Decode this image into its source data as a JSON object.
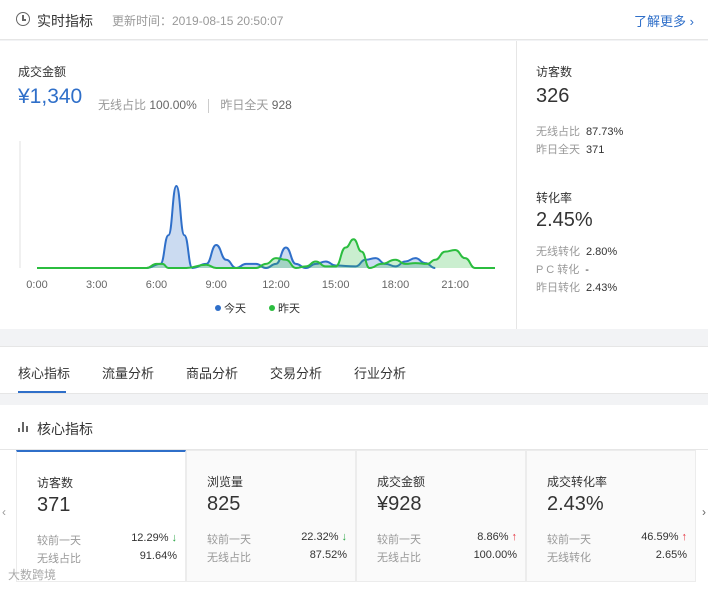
{
  "header": {
    "title": "实时指标",
    "update_time": "更新时间：2019-08-15 20:50:07",
    "more_link": "了解更多 ›"
  },
  "sales": {
    "label": "成交金额",
    "value": "¥1,340",
    "wireless_label": "无线占比",
    "wireless_value": "100.00%",
    "yesterday_label": "昨日全天",
    "yesterday_value": "928"
  },
  "visitors": {
    "label": "访客数",
    "value": "326",
    "rows": [
      {
        "label": "无线占比",
        "value": "87.73%"
      },
      {
        "label": "昨日全天",
        "value": "371"
      }
    ]
  },
  "conversion": {
    "label": "转化率",
    "value": "2.45%",
    "rows": [
      {
        "label": "无线转化",
        "value": "2.80%"
      },
      {
        "label": "P C 转化",
        "value": "-"
      },
      {
        "label": "昨日转化",
        "value": "2.43%"
      }
    ]
  },
  "chart_data": {
    "type": "area",
    "x": [
      "0:00",
      "3:00",
      "6:00",
      "9:00",
      "12:00",
      "15:00",
      "18:00",
      "21:00"
    ],
    "x_range": [
      0,
      23
    ],
    "series": [
      {
        "name": "今天",
        "color": "#2f6fc9",
        "points": [
          [
            0,
            0
          ],
          [
            5.5,
            0
          ],
          [
            6.2,
            0.05
          ],
          [
            6.6,
            0.4
          ],
          [
            7,
            1.0
          ],
          [
            7.4,
            0.4
          ],
          [
            7.8,
            0
          ],
          [
            8.5,
            0.05
          ],
          [
            9,
            0.28
          ],
          [
            9.5,
            0.1
          ],
          [
            10,
            0
          ],
          [
            10.5,
            0.05
          ],
          [
            11,
            0.05
          ],
          [
            11.5,
            0
          ],
          [
            12,
            0.05
          ],
          [
            12.5,
            0.25
          ],
          [
            13,
            0.05
          ],
          [
            13.5,
            0
          ],
          [
            14,
            0.05
          ],
          [
            14.5,
            0.08
          ],
          [
            15,
            0.03
          ],
          [
            16,
            0.02
          ],
          [
            16.5,
            0.1
          ],
          [
            17,
            0.12
          ],
          [
            17.5,
            0.05
          ],
          [
            18,
            0.02
          ],
          [
            18.5,
            0.08
          ],
          [
            19,
            0.12
          ],
          [
            19.5,
            0.06
          ],
          [
            20,
            0
          ]
        ]
      },
      {
        "name": "昨天",
        "color": "#2bbd3f",
        "points": [
          [
            0,
            0
          ],
          [
            5.5,
            0
          ],
          [
            6,
            0.05
          ],
          [
            6.3,
            0.05
          ],
          [
            6.6,
            0
          ],
          [
            7.5,
            0
          ],
          [
            8.5,
            0.04
          ],
          [
            9,
            0
          ],
          [
            11,
            0
          ],
          [
            11.5,
            0.05
          ],
          [
            12,
            0.12
          ],
          [
            12.5,
            0.1
          ],
          [
            13,
            0
          ],
          [
            13.5,
            0.02
          ],
          [
            14,
            0.08
          ],
          [
            14.5,
            0.02
          ],
          [
            15,
            0.02
          ],
          [
            15.5,
            0.25
          ],
          [
            15.9,
            0.35
          ],
          [
            16.3,
            0.2
          ],
          [
            16.7,
            0
          ],
          [
            17.3,
            0.05
          ],
          [
            18,
            0.1
          ],
          [
            18.5,
            0.05
          ],
          [
            19,
            0.06
          ],
          [
            19.6,
            0.05
          ],
          [
            20,
            0.1
          ],
          [
            20.5,
            0.2
          ],
          [
            21,
            0.22
          ],
          [
            21.5,
            0.12
          ],
          [
            22,
            0
          ],
          [
            23,
            0
          ]
        ]
      }
    ],
    "legend": [
      "今天",
      "昨天"
    ]
  },
  "tabs": [
    "核心指标",
    "流量分析",
    "商品分析",
    "交易分析",
    "行业分析"
  ],
  "core": {
    "title": "核心指标",
    "cards": [
      {
        "label": "访客数",
        "value": "371",
        "row1_label": "较前一天",
        "row1_value": "12.29%",
        "row1_dir": "down",
        "row2_label": "无线占比",
        "row2_value": "91.64%"
      },
      {
        "label": "浏览量",
        "value": "825",
        "row1_label": "较前一天",
        "row1_value": "22.32%",
        "row1_dir": "down",
        "row2_label": "无线占比",
        "row2_value": "87.52%"
      },
      {
        "label": "成交金额",
        "value": "¥928",
        "row1_label": "较前一天",
        "row1_value": "8.86%",
        "row1_dir": "up",
        "row2_label": "无线占比",
        "row2_value": "100.00%"
      },
      {
        "label": "成交转化率",
        "value": "2.43%",
        "row1_label": "较前一天",
        "row1_value": "46.59%",
        "row1_dir": "up",
        "row2_label": "无线转化",
        "row2_value": "2.65%"
      }
    ]
  },
  "arrows": {
    "down": "↓",
    "up": "↑",
    "left": "‹",
    "right": "›"
  },
  "watermark": "大数跨境"
}
